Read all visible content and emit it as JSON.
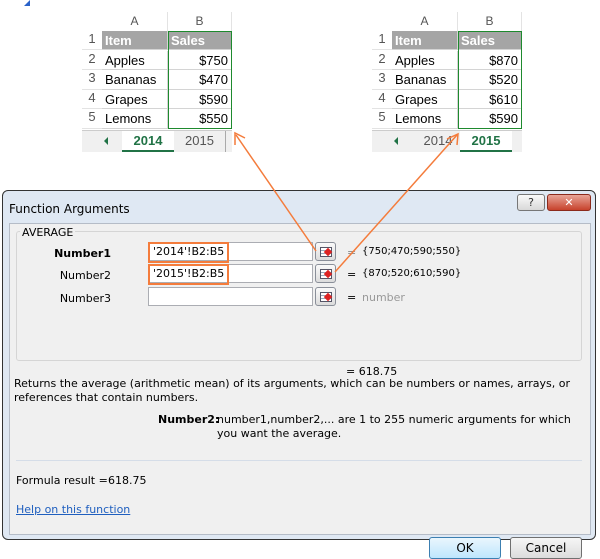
{
  "sheets": [
    {
      "col_headers": [
        "A",
        "B"
      ],
      "rows": [
        [
          "Item",
          "Sales"
        ],
        [
          "Apples",
          "$750"
        ],
        [
          "Bananas",
          "$470"
        ],
        [
          "Grapes",
          "$590"
        ],
        [
          "Lemons",
          "$550"
        ]
      ],
      "row_numbers": [
        "1",
        "2",
        "3",
        "4",
        "5"
      ],
      "tabs": [
        "2014",
        "2015"
      ],
      "active_tab": "2014"
    },
    {
      "col_headers": [
        "A",
        "B"
      ],
      "rows": [
        [
          "Item",
          "Sales"
        ],
        [
          "Apples",
          "$870"
        ],
        [
          "Bananas",
          "$520"
        ],
        [
          "Grapes",
          "$610"
        ],
        [
          "Lemons",
          "$590"
        ]
      ],
      "row_numbers": [
        "1",
        "2",
        "3",
        "4",
        "5"
      ],
      "tabs": [
        "2014",
        "2015"
      ],
      "active_tab": "2015"
    }
  ],
  "dialog": {
    "title": "Function Arguments",
    "help_button": "?",
    "close_button": "✕",
    "function_name": "AVERAGE",
    "args": [
      {
        "label": "Number1",
        "value": "'2014'!B2:B5",
        "eq": "=",
        "result": "{750;470;590;550}"
      },
      {
        "label": "Number2",
        "value": "'2015'!B2:B5",
        "eq": "=",
        "result": "{870;520;610;590}"
      },
      {
        "label": "Number3",
        "value": "",
        "eq": "=",
        "result": "number"
      }
    ],
    "total": "=  618.75",
    "description": "Returns the average (arithmetic mean) of its arguments, which can be numbers or names, arrays, or references that contain numbers.",
    "arg_help_label": "Number2:",
    "arg_help_text": "number1,number2,... are 1 to 255 numeric arguments for which you want the average.",
    "formula_result_label": "Formula result =",
    "formula_result": "618.75",
    "help_link": "Help on this function",
    "ok": "OK",
    "cancel": "Cancel"
  },
  "colors": {
    "accent_orange": "#f47c3c",
    "excel_green": "#217346"
  }
}
